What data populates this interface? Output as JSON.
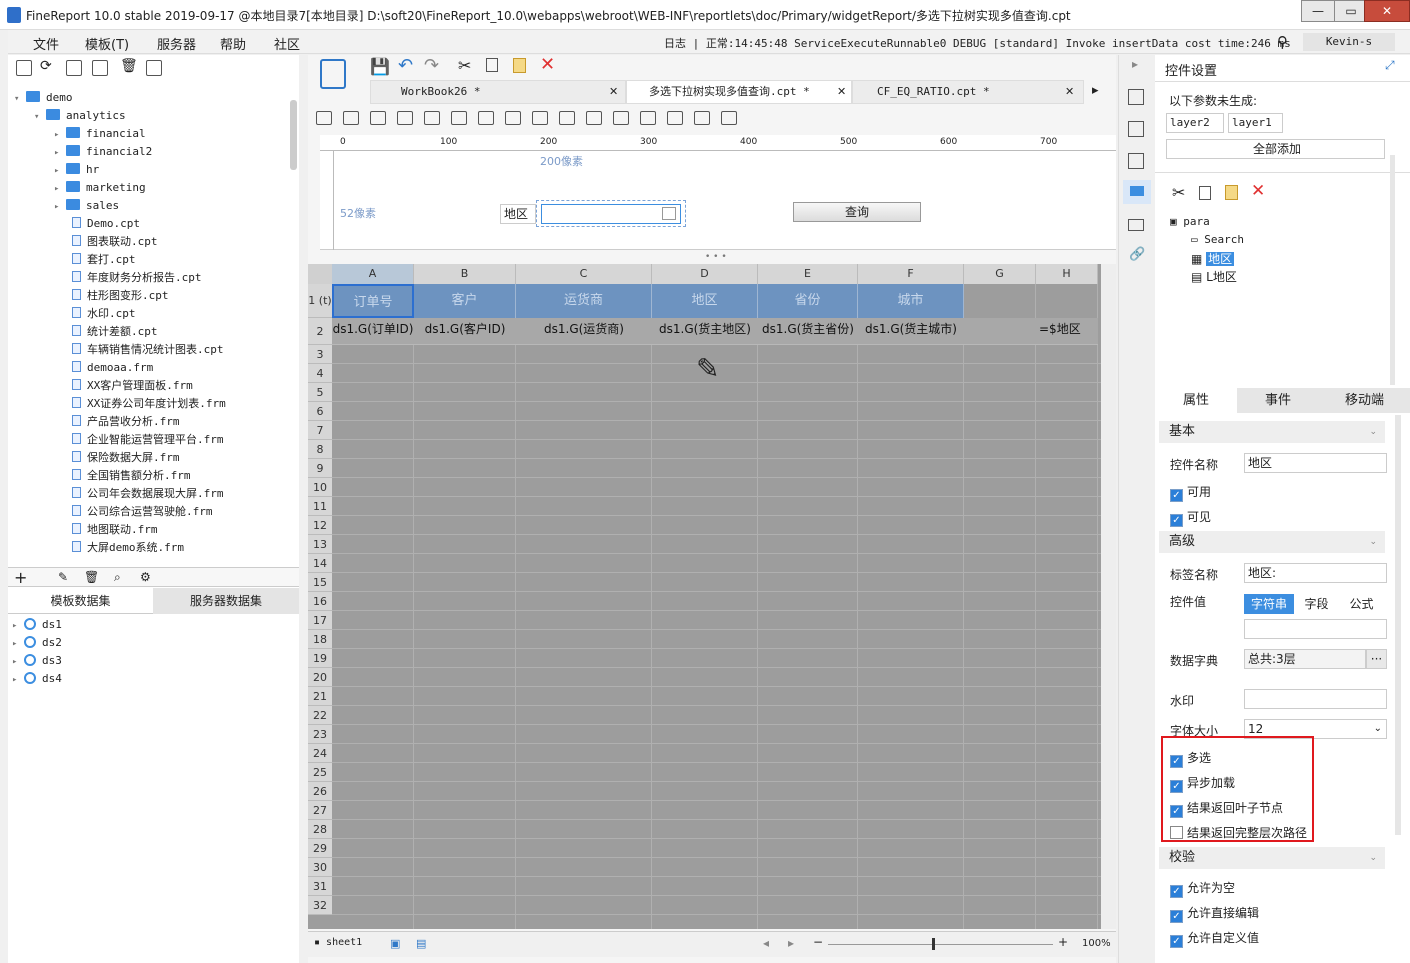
{
  "window": {
    "title": "FineReport 10.0 stable 2019-09-17 @本地目录7[本地目录]     D:\\soft20\\FineReport_10.0\\webapps\\webroot\\WEB-INF\\reportlets\\doc/Primary/widgetReport/多选下拉树实现多值查询.cpt",
    "min": "—",
    "max": "▭",
    "close": "✕"
  },
  "menu": {
    "items": [
      "文件",
      "模板(T)",
      "服务器",
      "帮助",
      "社区"
    ],
    "log": "日志 | 正常:14:45:48 ServiceExecuteRunnable0 DEBUG [standard] Invoke insertData cost time:246 ms",
    "user": "Kevin-s"
  },
  "filetree": {
    "items": [
      {
        "label": "demo",
        "type": "folder",
        "level": 0,
        "open": true
      },
      {
        "label": "analytics",
        "type": "folder",
        "level": 1,
        "open": true
      },
      {
        "label": "financial",
        "type": "folder",
        "level": 2
      },
      {
        "label": "financial2",
        "type": "folder",
        "level": 2
      },
      {
        "label": "hr",
        "type": "folder",
        "level": 2
      },
      {
        "label": "marketing",
        "type": "folder",
        "level": 2
      },
      {
        "label": "sales",
        "type": "folder",
        "level": 2
      },
      {
        "label": "Demo.cpt",
        "type": "file",
        "level": 2
      },
      {
        "label": "图表联动.cpt",
        "type": "file",
        "level": 2
      },
      {
        "label": "套打.cpt",
        "type": "file",
        "level": 2
      },
      {
        "label": "年度财务分析报告.cpt",
        "type": "file",
        "level": 2
      },
      {
        "label": "柱形图变形.cpt",
        "type": "file",
        "level": 2
      },
      {
        "label": "水印.cpt",
        "type": "file",
        "level": 2
      },
      {
        "label": "统计差额.cpt",
        "type": "file",
        "level": 2
      },
      {
        "label": "车辆销售情况统计图表.cpt",
        "type": "file",
        "level": 2
      },
      {
        "label": "demoaa.frm",
        "type": "file",
        "level": 2
      },
      {
        "label": "XX客户管理面板.frm",
        "type": "file",
        "level": 2
      },
      {
        "label": "XX证券公司年度计划表.frm",
        "type": "file",
        "level": 2
      },
      {
        "label": "产品营收分析.frm",
        "type": "file",
        "level": 2
      },
      {
        "label": "企业智能运营管理平台.frm",
        "type": "file",
        "level": 2
      },
      {
        "label": "保险数据大屏.frm",
        "type": "file",
        "level": 2
      },
      {
        "label": "全国销售额分析.frm",
        "type": "file",
        "level": 2
      },
      {
        "label": "公司年会数据展现大屏.frm",
        "type": "file",
        "level": 2
      },
      {
        "label": "公司综合运营驾驶舱.frm",
        "type": "file",
        "level": 2
      },
      {
        "label": "地图联动.frm",
        "type": "file",
        "level": 2
      },
      {
        "label": "大屏demo系统.frm",
        "type": "file",
        "level": 2
      }
    ]
  },
  "datasets": {
    "tabs": [
      "模板数据集",
      "服务器数据集"
    ],
    "items": [
      "ds1",
      "ds2",
      "ds3",
      "ds4"
    ]
  },
  "tabs": [
    {
      "label": "WorkBook26 *"
    },
    {
      "label": "多选下拉树实现多值查询.cpt *"
    },
    {
      "label": "CF_EQ_RATIO.cpt *"
    }
  ],
  "param_pane": {
    "ruler": [
      "0",
      "100",
      "200",
      "300",
      "400",
      "500",
      "600",
      "700"
    ],
    "width_label": "200像素",
    "height_label": "52像素",
    "region_label": "地区",
    "query_button": "查询"
  },
  "grid": {
    "columns": [
      "A",
      "B",
      "C",
      "D",
      "E",
      "F",
      "G",
      "H"
    ],
    "header_row": [
      "订单号",
      "客户",
      "运货商",
      "地区",
      "省份",
      "城市"
    ],
    "data_row": [
      "ds1.G(订单ID)",
      "ds1.G(客户ID)",
      "ds1.G(运货商)",
      "ds1.G(货主地区)",
      "ds1.G(货主省份)",
      "ds1.G(货主城市)",
      "",
      "=$地区"
    ],
    "row_numbers": [
      "1 (t)",
      "2",
      "3",
      "4",
      "5",
      "6",
      "7",
      "8",
      "9",
      "10",
      "11",
      "12",
      "13",
      "14",
      "15",
      "16",
      "17",
      "18",
      "19",
      "20",
      "21",
      "22",
      "23",
      "24",
      "25",
      "26",
      "27",
      "28",
      "29",
      "30",
      "31",
      "32"
    ],
    "sheet_tab": "sheet1",
    "zoom": "100%"
  },
  "right": {
    "title": "控件设置",
    "not_generated": "以下参数未生成:",
    "params": [
      "layer2",
      "layer1"
    ],
    "add_all": "全部添加",
    "tree": [
      "para",
      "Search",
      "地区",
      "L地区"
    ],
    "prop_tabs": [
      "属性",
      "事件",
      "移动端"
    ],
    "sec_basic": "基本",
    "name_label": "控件名称",
    "name_value": "地区",
    "enabled": "可用",
    "visible": "可见",
    "sec_advanced": "高级",
    "tag_label": "标签名称",
    "tag_value": "地区:",
    "value_label": "控件值",
    "value_types": [
      "字符串",
      "字段",
      "公式"
    ],
    "dict_label": "数据字典",
    "dict_value": "总共:3层",
    "dict_btn": "···",
    "watermark_label": "水印",
    "font_label": "字体大小",
    "font_value": "12",
    "opt_multi": "多选",
    "opt_async": "异步加载",
    "opt_leaf": "结果返回叶子节点",
    "opt_path": "结果返回完整层次路径",
    "sec_check": "校验",
    "allow_empty": "允许为空",
    "allow_edit": "允许直接编辑",
    "allow_custom": "允许自定义值"
  }
}
